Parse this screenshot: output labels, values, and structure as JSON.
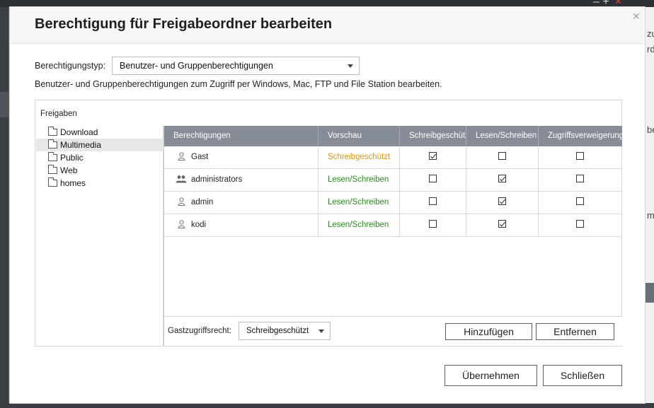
{
  "background": {
    "right_text": [
      "zu",
      "rd",
      "be",
      "me"
    ]
  },
  "dialog": {
    "title": "Berechtigung für Freigabeordner bearbeiten",
    "close_label": "×",
    "permission_type": {
      "label": "Berechtigungstyp:",
      "selected": "Benutzer- und Gruppenberechtigungen"
    },
    "description": "Benutzer- und Gruppenberechtigungen zum Zugriff per Windows, Mac, FTP und File Station bearbeiten.",
    "shares_panel": {
      "title": "Freigaben",
      "folders": [
        {
          "label": "Download",
          "selected": false
        },
        {
          "label": "Multimedia",
          "selected": true
        },
        {
          "label": "Public",
          "selected": false
        },
        {
          "label": "Web",
          "selected": false
        },
        {
          "label": "homes",
          "selected": false
        }
      ]
    },
    "table": {
      "columns": [
        "Berechtigungen",
        "Vorschau",
        "Schreibgeschützt",
        "Lesen/Schreiben",
        "Zugriffsverweigerung"
      ],
      "rows": [
        {
          "name": "Gast",
          "icon": "user-icon",
          "preview": "Schreibgeschützt",
          "preview_color": "#e59400",
          "read_only": true,
          "read_write": false,
          "deny": false
        },
        {
          "name": "administrators",
          "icon": "group-icon",
          "preview": "Lesen/Schreiben",
          "preview_color": "#2b8a1f",
          "read_only": false,
          "read_write": true,
          "deny": false
        },
        {
          "name": "admin",
          "icon": "user-icon",
          "preview": "Lesen/Schreiben",
          "preview_color": "#2b8a1f",
          "read_only": false,
          "read_write": true,
          "deny": false
        },
        {
          "name": "kodi",
          "icon": "user-icon",
          "preview": "Lesen/Schreiben",
          "preview_color": "#2b8a1f",
          "read_only": false,
          "read_write": true,
          "deny": false
        }
      ]
    },
    "guest_access": {
      "label": "Gastzugriffsrecht:",
      "selected": "Schreibgeschützt"
    },
    "buttons": {
      "add": "Hinzufügen",
      "remove": "Entfernen",
      "apply": "Übernehmen",
      "close": "Schließen"
    }
  }
}
